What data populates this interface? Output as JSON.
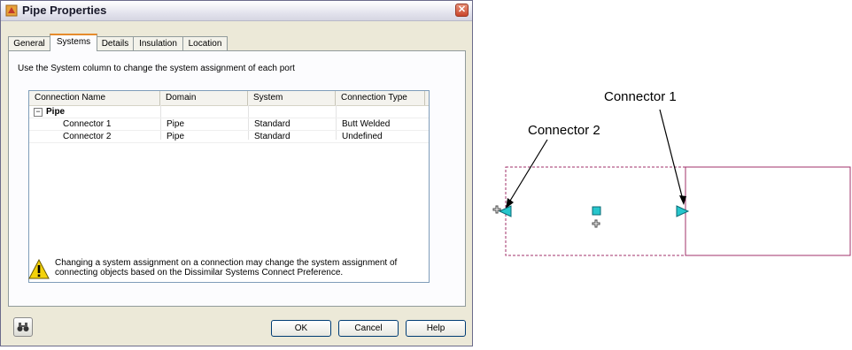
{
  "dialog": {
    "title": "Pipe Properties",
    "close_glyph": "✕",
    "tabs": [
      "General",
      "Systems",
      "Details",
      "Insulation",
      "Location"
    ],
    "active_tab": "Systems",
    "instruction": "Use the System column to change the system assignment of each port",
    "grid": {
      "columns": [
        "Connection Name",
        "Domain",
        "System",
        "Connection Type"
      ],
      "group": {
        "expander": "−",
        "label": "Pipe"
      },
      "rows": [
        {
          "name": "Connector 1",
          "domain": "Pipe",
          "system": "Standard",
          "type": "Butt Welded"
        },
        {
          "name": "Connector 2",
          "domain": "Pipe",
          "system": "Standard",
          "type": "Undefined"
        }
      ]
    },
    "warning": "Changing a system assignment on a connection may change the system assignment of connecting objects based on the Dissimilar Systems Connect Preference.",
    "buttons": {
      "ok": "OK",
      "cancel": "Cancel",
      "help": "Help"
    }
  },
  "drawing": {
    "callout_1": "Connector 1",
    "callout_2": "Connector 2",
    "colors": {
      "connector": "#27c6cc",
      "outline": "#a0306a",
      "arrow": "#000000"
    }
  }
}
